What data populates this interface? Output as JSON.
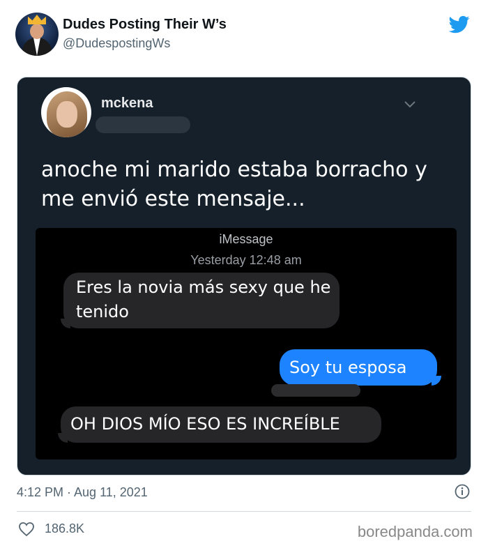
{
  "account": {
    "name": "Dudes Posting Their W’s",
    "handle": "@DudespostingWs"
  },
  "embedded": {
    "name": "mckena",
    "caption": "anoche mi marido estaba borracho y me envió este mensaje..."
  },
  "imessage": {
    "title": "iMessage",
    "timestamp": "Yesterday 12:48 am",
    "messages": [
      {
        "side": "left",
        "text": "Eres la novia más sexy que he tenido"
      },
      {
        "side": "right",
        "text": "Soy tu esposa"
      },
      {
        "side": "left",
        "text": "OH DIOS MÍO ESO ES INCREÍBLE"
      }
    ]
  },
  "tweet": {
    "time": "4:12 PM · Aug 11, 2021",
    "likes": "186.8K"
  },
  "watermark": "boredpanda.com",
  "colors": {
    "twitter_blue": "#1d9bf0",
    "card_bg": "#15202b",
    "imessage_blue": "#1e83ff",
    "received_bubble": "#262629"
  },
  "icons": [
    "twitter-bird-icon",
    "chevron-down-icon",
    "info-icon",
    "heart-icon"
  ]
}
